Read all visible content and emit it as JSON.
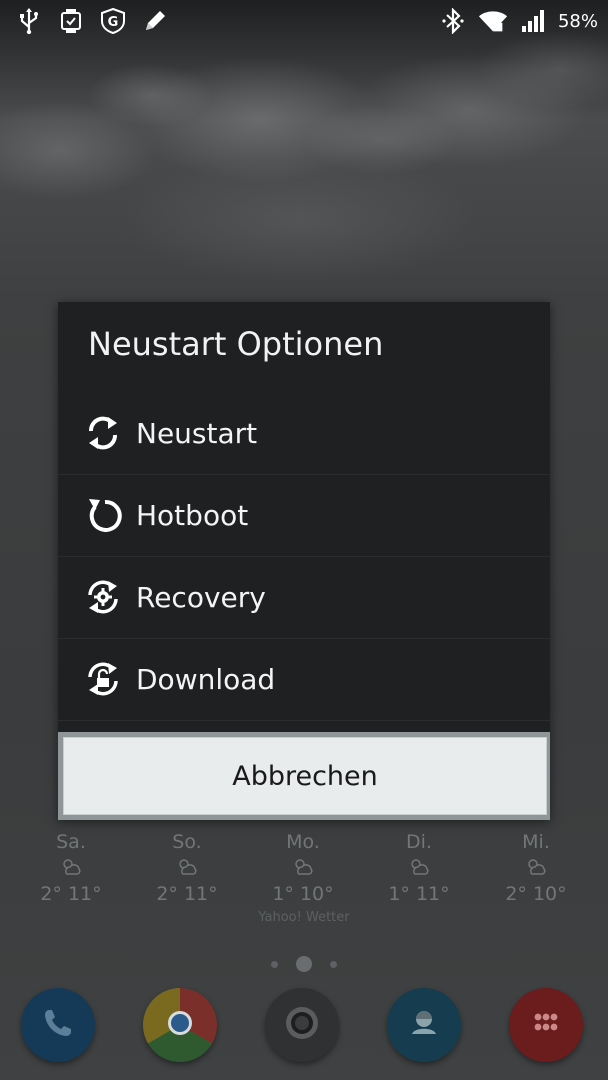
{
  "status_bar": {
    "left_icons": [
      "usb-icon",
      "smartwatch-icon",
      "g-data-icon",
      "pencil-icon"
    ],
    "right_icons": [
      "bluetooth-icon",
      "wifi-icon",
      "signal-icon"
    ],
    "battery": "58%"
  },
  "dialog": {
    "title": "Neustart Optionen",
    "options": [
      {
        "label": "Neustart",
        "icon": "refresh-icon"
      },
      {
        "label": "Hotboot",
        "icon": "hotboot-icon"
      },
      {
        "label": "Recovery",
        "icon": "recovery-gear-icon"
      },
      {
        "label": "Download",
        "icon": "download-lock-icon"
      }
    ],
    "cancel": "Abbrechen"
  },
  "weather": {
    "days": [
      {
        "name": "Sa.",
        "temp": "2° 11°"
      },
      {
        "name": "So.",
        "temp": "2° 11°"
      },
      {
        "name": "Mo.",
        "temp": "1° 10°"
      },
      {
        "name": "Di.",
        "temp": "1° 11°"
      },
      {
        "name": "Mi.",
        "temp": "2° 10°"
      }
    ],
    "source": "Yahoo! Wetter"
  },
  "dock": {
    "apps": [
      "phone-icon",
      "chrome-icon",
      "camera-icon",
      "contacts-icon",
      "app-drawer-icon"
    ]
  }
}
